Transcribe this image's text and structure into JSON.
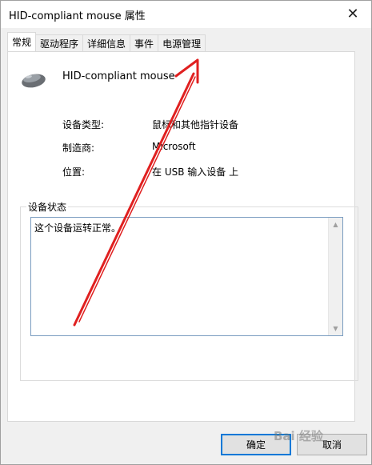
{
  "window": {
    "title": "HID-compliant mouse 属性",
    "close_glyph": "✕"
  },
  "tabs": [
    {
      "label": "常规",
      "active": true
    },
    {
      "label": "驱动程序",
      "active": false
    },
    {
      "label": "详细信息",
      "active": false
    },
    {
      "label": "事件",
      "active": false
    },
    {
      "label": "电源管理",
      "active": false
    }
  ],
  "device": {
    "name": "HID-compliant mouse",
    "icon": "mouse-icon"
  },
  "properties": [
    {
      "label": "设备类型:",
      "value": "鼠标和其他指针设备"
    },
    {
      "label": "制造商:",
      "value": "Microsoft"
    },
    {
      "label": "位置:",
      "value": "在 USB 输入设备 上"
    }
  ],
  "status": {
    "title": "设备状态",
    "text": "这个设备运转正常。"
  },
  "buttons": {
    "ok": "确定",
    "cancel": "取消"
  },
  "watermark": "Bai 经验",
  "colors": {
    "annotation_arrow": "#e02020",
    "focus_border": "#0078d7"
  }
}
